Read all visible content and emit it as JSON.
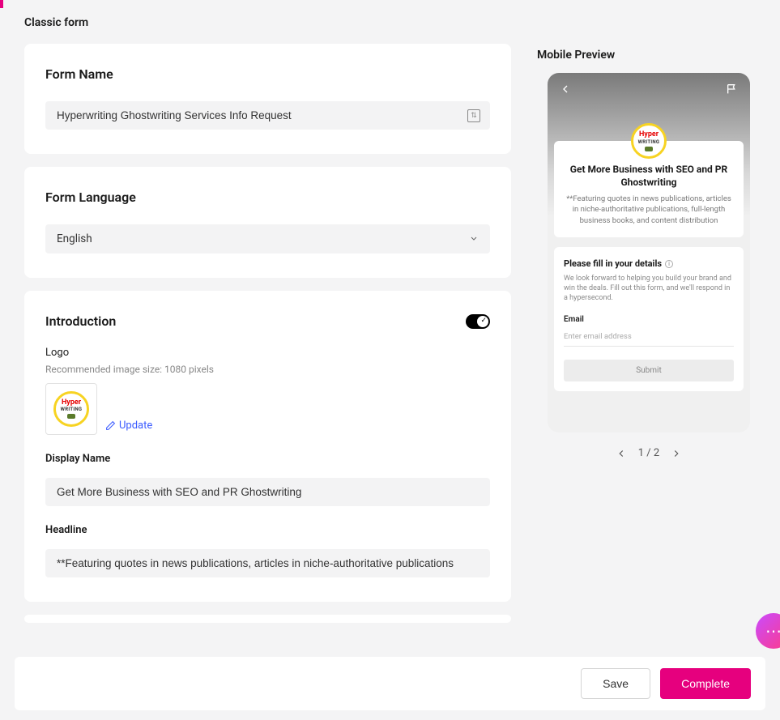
{
  "page": {
    "title": "Classic form"
  },
  "formName": {
    "heading": "Form Name",
    "value": "Hyperwriting Ghostwriting Services Info Request"
  },
  "formLanguage": {
    "heading": "Form Language",
    "value": "English"
  },
  "introduction": {
    "heading": "Introduction",
    "toggle_on": true,
    "logo": {
      "label": "Logo",
      "hint": "Recommended image size: 1080 pixels",
      "brand_line1": "Hyper",
      "brand_line2": "WRITING",
      "update_label": "Update"
    },
    "displayName": {
      "label": "Display Name",
      "value": "Get More Business with SEO and PR Ghostwriting"
    },
    "headline": {
      "label": "Headline",
      "value": "**Featuring quotes in news publications, articles in niche-authoritative publications"
    }
  },
  "preview": {
    "title": "Mobile Preview",
    "card": {
      "title": "Get More Business with SEO and PR Ghostwriting",
      "desc": "**Featuring quotes in news publications, articles in niche-authoritative publications, full-length business books, and content distribution"
    },
    "form": {
      "title": "Please fill in your details",
      "desc": "We look forward to helping you build your brand and win the deals. Fill out this form, and we'll respond in a hypersecond.",
      "email_label": "Email",
      "email_placeholder": "Enter email address",
      "submit_label": "Submit"
    },
    "pager": {
      "current": 1,
      "total": 2,
      "text": "1 / 2"
    }
  },
  "footer": {
    "save": "Save",
    "complete": "Complete"
  },
  "logoBrand": {
    "line1": "Hyper",
    "line2": "WRITING"
  }
}
